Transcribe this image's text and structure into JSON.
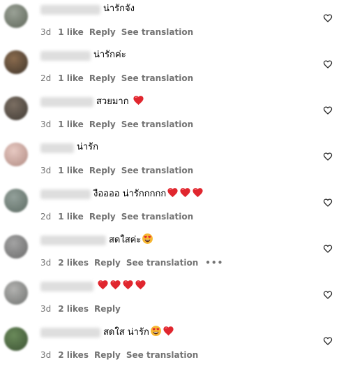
{
  "comments": [
    {
      "text": "น่ารักจัง",
      "emojis": [],
      "time": "3d",
      "likes": "1 like",
      "reply": "Reply",
      "translate": "See translation",
      "more": false
    },
    {
      "text": "น่ารักค่ะ",
      "emojis": [],
      "time": "2d",
      "likes": "1 like",
      "reply": "Reply",
      "translate": "See translation",
      "more": false
    },
    {
      "text": "สวยมาก ",
      "emojis": [
        "red-heart"
      ],
      "time": "3d",
      "likes": "1 like",
      "reply": "Reply",
      "translate": "See translation",
      "more": false
    },
    {
      "text": "น่ารัก",
      "emojis": [],
      "time": "3d",
      "likes": "1 like",
      "reply": "Reply",
      "translate": "See translation",
      "more": false
    },
    {
      "text": "งืออออ น่ารักกกกก",
      "emojis": [
        "red-heart",
        "red-heart",
        "red-heart"
      ],
      "time": "2d",
      "likes": "1 like",
      "reply": "Reply",
      "translate": "See translation",
      "more": false
    },
    {
      "text": "สดใสค่ะ",
      "emojis": [
        "heart-eyes"
      ],
      "time": "3d",
      "likes": "2 likes",
      "reply": "Reply",
      "translate": "See translation",
      "more": true
    },
    {
      "text": "",
      "emojis": [
        "red-heart",
        "red-heart",
        "red-heart",
        "red-heart"
      ],
      "time": "3d",
      "likes": "2 likes",
      "reply": "Reply",
      "translate": "",
      "more": false
    },
    {
      "text": "สดใส น่ารัก",
      "emojis": [
        "heart-eyes",
        "red-heart"
      ],
      "time": "3d",
      "likes": "2 likes",
      "reply": "Reply",
      "translate": "See translation",
      "more": false
    }
  ],
  "colors": {
    "meta_text": "#737373",
    "heart_red": "#e0262e",
    "emoji_yellow": "#f7b733",
    "username_blur": "#dedede"
  },
  "icons": {
    "like": "heart-outline-icon",
    "more": "more-options-icon"
  }
}
